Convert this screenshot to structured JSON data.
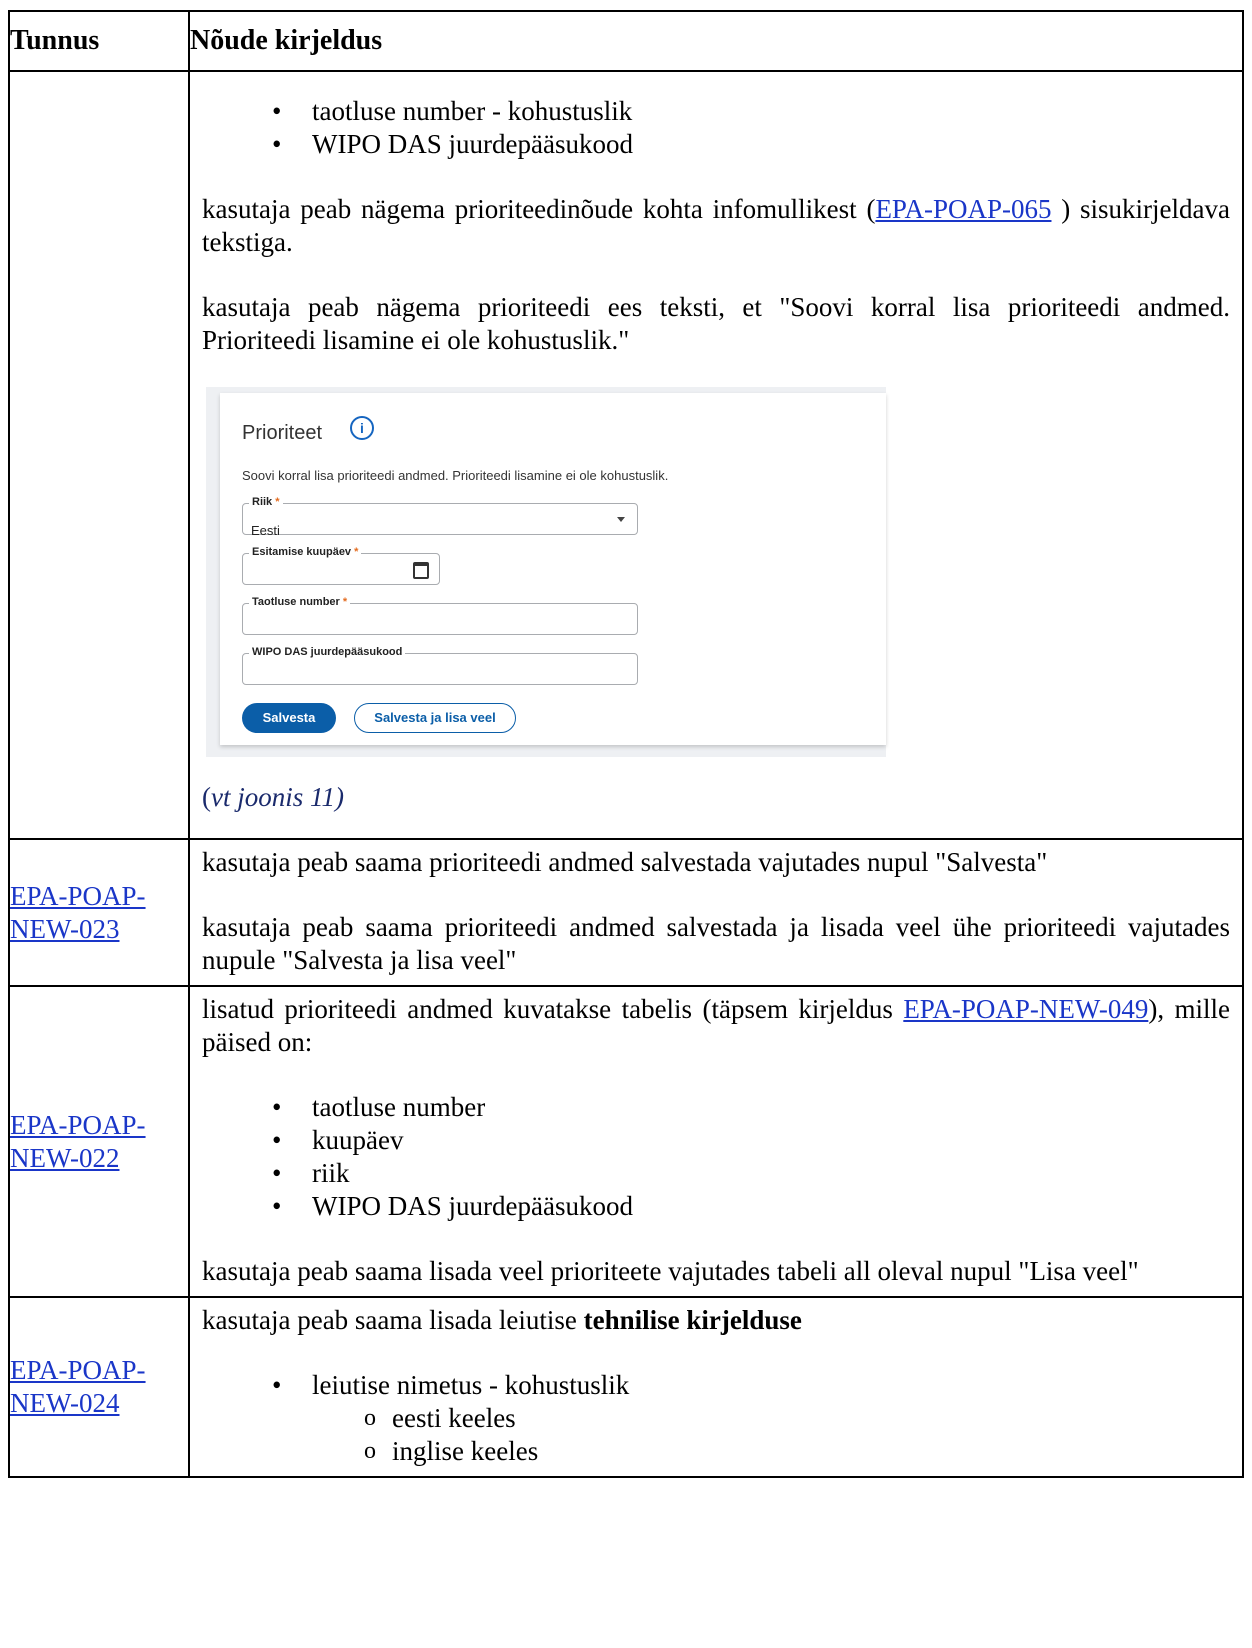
{
  "header": {
    "col1": "Tunnus",
    "col2": "Nõude kirjeldus"
  },
  "row1": {
    "bullets": [
      "taotluse number - kohustuslik",
      "WIPO DAS juurdepääsukood"
    ],
    "p1_pre": "kasutaja peab nägema prioriteedinõude kohta infomullikest (",
    "p1_link": "EPA-POAP-065",
    "p1_post": " ) sisukirjeldava tekstiga.",
    "p2": "kasutaja peab nägema prioriteedi ees teksti, et \"Soovi korral lisa prioriteedi andmed. Prioriteedi lisamine ei ole kohustuslik.\"",
    "form": {
      "title": "Prioriteet",
      "hint": "Soovi korral lisa prioriteedi andmed. Prioriteedi lisamine ei ole kohustuslik.",
      "country_label": "Riik",
      "country_value": "Eesti",
      "date_label": "Esitamise kuupäev",
      "appno_label": "Taotluse number",
      "wipo_label": "WIPO DAS juurdepääsukood",
      "required_mark": "*",
      "save": "Salvesta",
      "save_add": "Salvesta ja lisa veel"
    },
    "figure_open": "(",
    "figure_ref": "vt joonis 11)"
  },
  "row2": {
    "id": "EPA-POAP-NEW-023",
    "p1": "kasutaja peab saama prioriteedi andmed salvestada vajutades nupul \"Salvesta\"",
    "p2": "kasutaja peab saama prioriteedi andmed salvestada ja lisada veel ühe prioriteedi vajutades nupule \"Salvesta ja lisa veel\""
  },
  "row3": {
    "id": "EPA-POAP-NEW-022",
    "p1_pre": "lisatud prioriteedi andmed kuvatakse tabelis (täpsem kirjeldus ",
    "p1_link": "EPA-POAP-NEW-049",
    "p1_post": "), mille päised on:",
    "bullets": [
      "taotluse number",
      "kuupäev",
      "riik",
      "WIPO DAS juurdepääsukood"
    ],
    "p2": "kasutaja peab saama lisada veel prioriteete vajutades tabeli all oleval nupul \"Lisa veel\""
  },
  "row4": {
    "id": "EPA-POAP-NEW-024",
    "p1_pre": "kasutaja peab saama lisada leiutise ",
    "p1_bold": "tehnilise kirjelduse",
    "bullet": "leiutise nimetus - kohustuslik",
    "sub": [
      "eesti keeles",
      "inglise keeles"
    ]
  }
}
